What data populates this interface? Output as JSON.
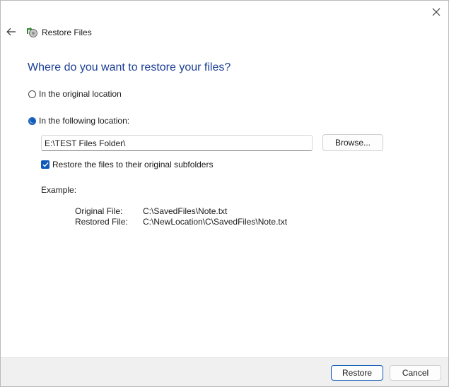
{
  "window": {
    "title": "Restore Files",
    "icons": {
      "close": "close-icon",
      "back": "back-arrow-icon",
      "app": "restore-files-icon"
    }
  },
  "main": {
    "heading": "Where do you want to restore your files?",
    "options": [
      {
        "label": "In the original location",
        "selected": false
      },
      {
        "label": "In the following location:",
        "selected": true
      }
    ],
    "location_value": "E:\\TEST Files Folder\\",
    "browse_label": "Browse...",
    "subfolders_label": "Restore the files to their original subfolders",
    "subfolders_checked": true,
    "example": {
      "label": "Example:",
      "rows": [
        {
          "key": "Original File:",
          "value": "C:\\SavedFiles\\Note.txt"
        },
        {
          "key": "Restored File:",
          "value": "C:\\NewLocation\\C\\SavedFiles\\Note.txt"
        }
      ]
    }
  },
  "footer": {
    "restore_label": "Restore",
    "cancel_label": "Cancel"
  },
  "colors": {
    "accent": "#0f5ab8",
    "heading": "#1c3f94",
    "footer_bg": "#f0f0f0"
  }
}
